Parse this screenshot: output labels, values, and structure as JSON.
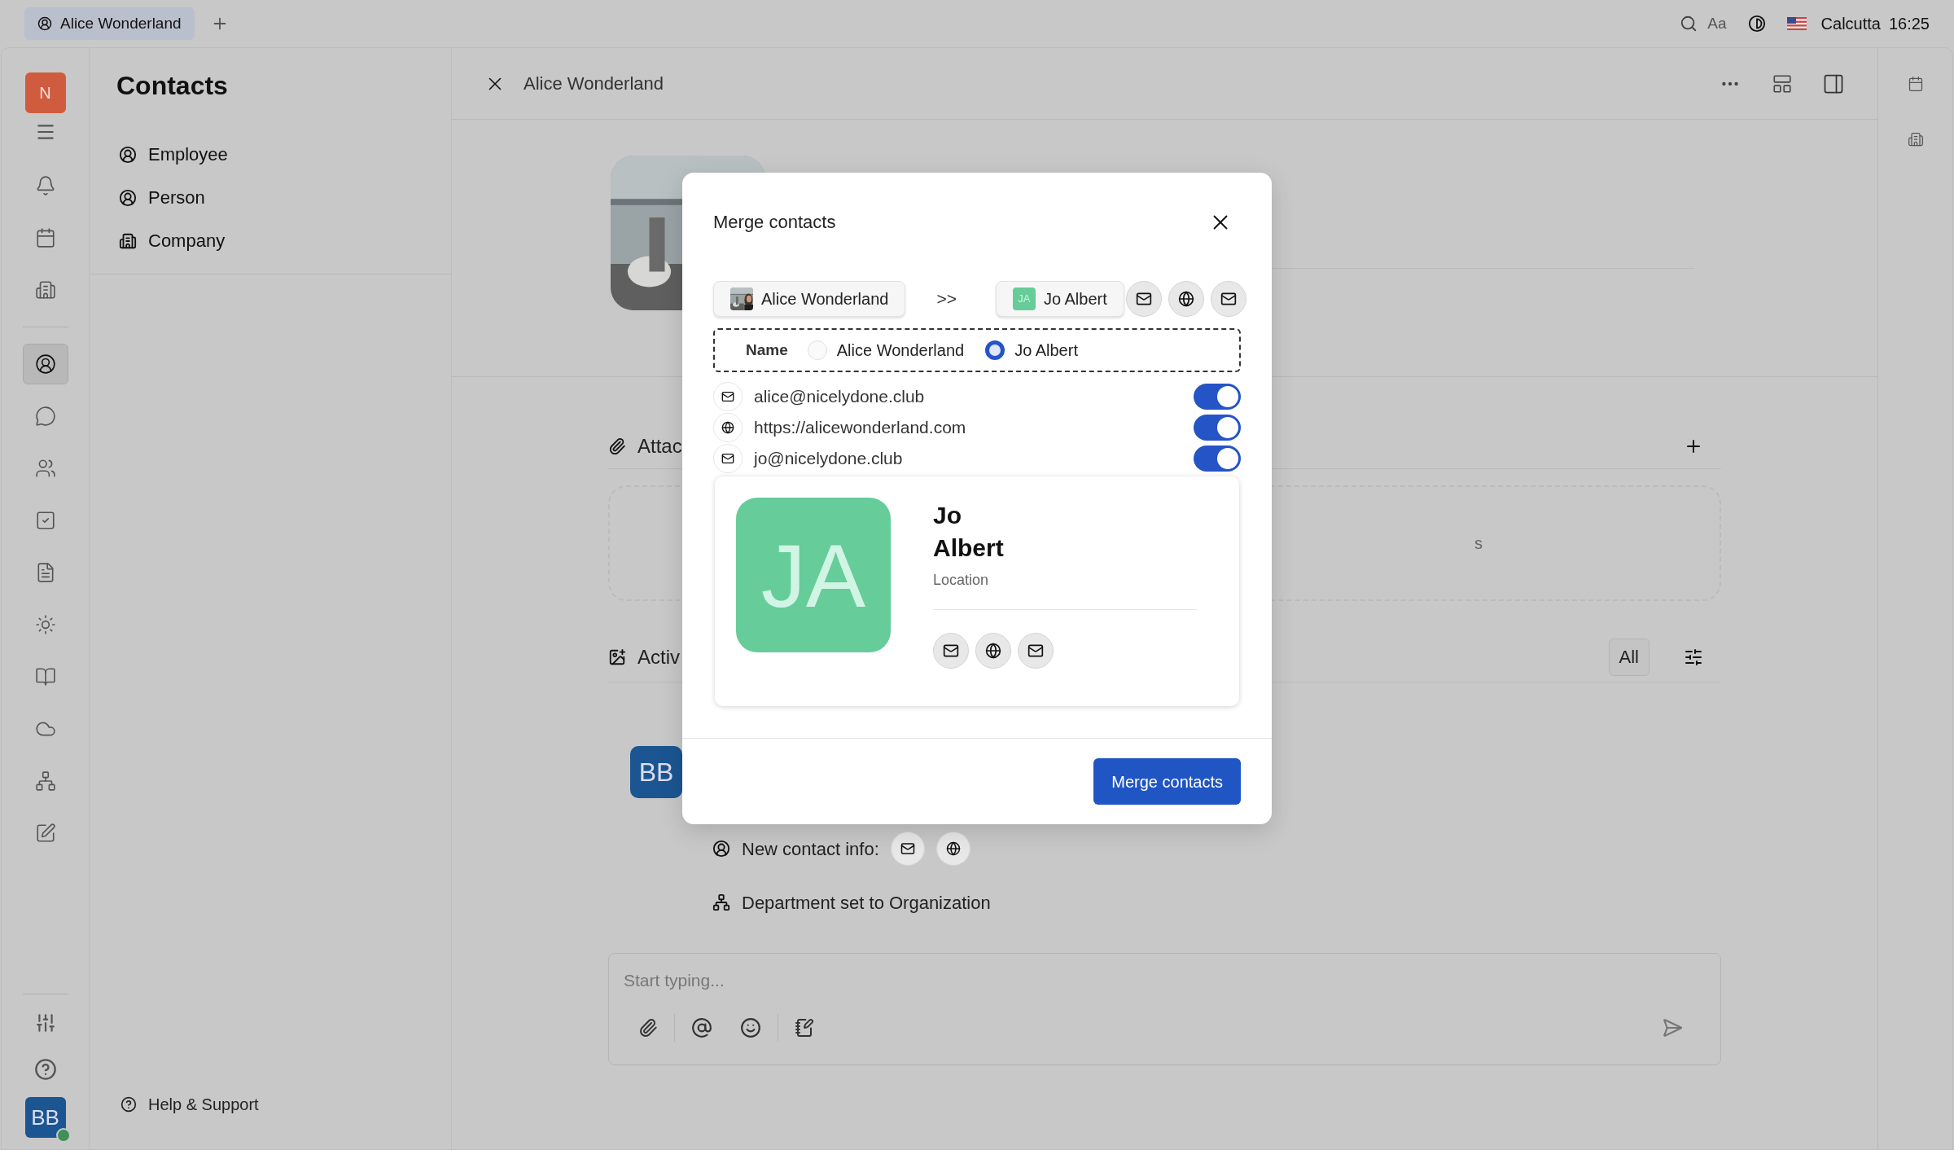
{
  "topbar": {
    "tab": {
      "label": "Alice Wonderland",
      "selected": true
    },
    "font_button": "Aa",
    "location": "Calcutta",
    "time": "16:25"
  },
  "rail": {
    "logo": "N",
    "items": [
      {
        "selected": false
      },
      {
        "selected": false
      },
      {
        "selected": false
      },
      {
        "selected": true
      },
      {
        "selected": false
      },
      {
        "selected": false
      },
      {
        "selected": false
      },
      {
        "selected": false
      },
      {
        "selected": false
      },
      {
        "selected": false
      },
      {
        "selected": false
      },
      {
        "selected": false
      },
      {
        "selected": false
      }
    ],
    "avatar": "BB",
    "online": true
  },
  "nav": {
    "title": "Contacts",
    "items": [
      {
        "label": "Employee",
        "kind": "person"
      },
      {
        "label": "Person",
        "kind": "person"
      },
      {
        "label": "Company",
        "kind": "company"
      }
    ],
    "help": "Help & Support"
  },
  "main": {
    "title": "Alice Wonderland",
    "attachments_title": "Attac",
    "dropzone_fragment": "s",
    "activity_title": "Activ",
    "filter": "All",
    "activity_avatar": "BB",
    "entries": [
      {
        "kind": "contact_info",
        "text": "New contact info:",
        "channels": [
          {
            "kind": "email"
          },
          {
            "kind": "web"
          }
        ]
      },
      {
        "kind": "department",
        "text": "Department set to Organization"
      }
    ],
    "composer": {
      "placeholder": "Start typing..."
    }
  },
  "modal": {
    "title": "Merge contacts",
    "source": {
      "name": "Alice Wonderland"
    },
    "separator": ">>",
    "target": {
      "name": "Jo Albert",
      "initials": "JA"
    },
    "target_channels": [
      {
        "kind": "email"
      },
      {
        "kind": "web"
      },
      {
        "kind": "email"
      }
    ],
    "name_field": {
      "label": "Name",
      "options": [
        {
          "label": "Alice Wonderland",
          "selected": false
        },
        {
          "label": "Jo Albert",
          "selected": true
        }
      ]
    },
    "channels": [
      {
        "kind": "email",
        "value": "alice@nicelydone.club",
        "on": true
      },
      {
        "kind": "web",
        "value": "https://alicewonderland.com",
        "on": true
      },
      {
        "kind": "email",
        "value": "jo@nicelydone.club",
        "on": true
      }
    ],
    "preview": {
      "initials": "JA",
      "first_name": "Jo",
      "last_name": "Albert",
      "location": "Location",
      "channels": [
        {
          "kind": "email"
        },
        {
          "kind": "web"
        },
        {
          "kind": "email"
        }
      ]
    },
    "button": "Merge contacts"
  }
}
